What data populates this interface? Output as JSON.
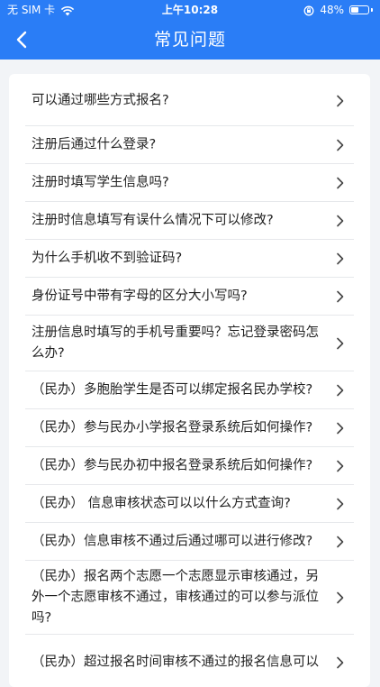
{
  "status_bar": {
    "carrier": "无 SIM 卡",
    "time": "上午10:28",
    "battery_percent_text": "48%",
    "battery_level": 0.48,
    "icons": [
      "wifi-icon",
      "rotation-lock-icon",
      "battery-icon"
    ]
  },
  "navbar": {
    "title": "常见问题",
    "back_icon": "chevron-left-icon"
  },
  "colors": {
    "header": "#2a7df6",
    "background": "#f2f4f7",
    "card": "#ffffff",
    "divider": "#e6e8eb"
  },
  "faq": [
    {
      "question": "可以通过哪些方式报名?"
    },
    {
      "question": "注册后通过什么登录?"
    },
    {
      "question": "注册时填写学生信息吗?"
    },
    {
      "question": "注册时信息填写有误什么情况下可以修改?"
    },
    {
      "question": "为什么手机收不到验证码?"
    },
    {
      "question": "身份证号中带有字母的区分大小写吗?"
    },
    {
      "question": "注册信息时填写的手机号重要吗？忘记登录密码怎么办?"
    },
    {
      "question": "（民办）多胞胎学生是否可以绑定报名民办学校?"
    },
    {
      "question": "（民办）参与民办小学报名登录系统后如何操作?"
    },
    {
      "question": "（民办）参与民办初中报名登录系统后如何操作?"
    },
    {
      "question": "（民办） 信息审核状态可以以什么方式查询?"
    },
    {
      "question": "（民办）信息审核不通过后通过哪可以进行修改?"
    },
    {
      "question": "（民办）报名两个志愿一个志愿显示审核通过，另外一个志愿审核不通过，审核通过的可以参与派位吗?"
    },
    {
      "question": "（民办）超过报名时间审核不通过的报名信息可以"
    }
  ]
}
